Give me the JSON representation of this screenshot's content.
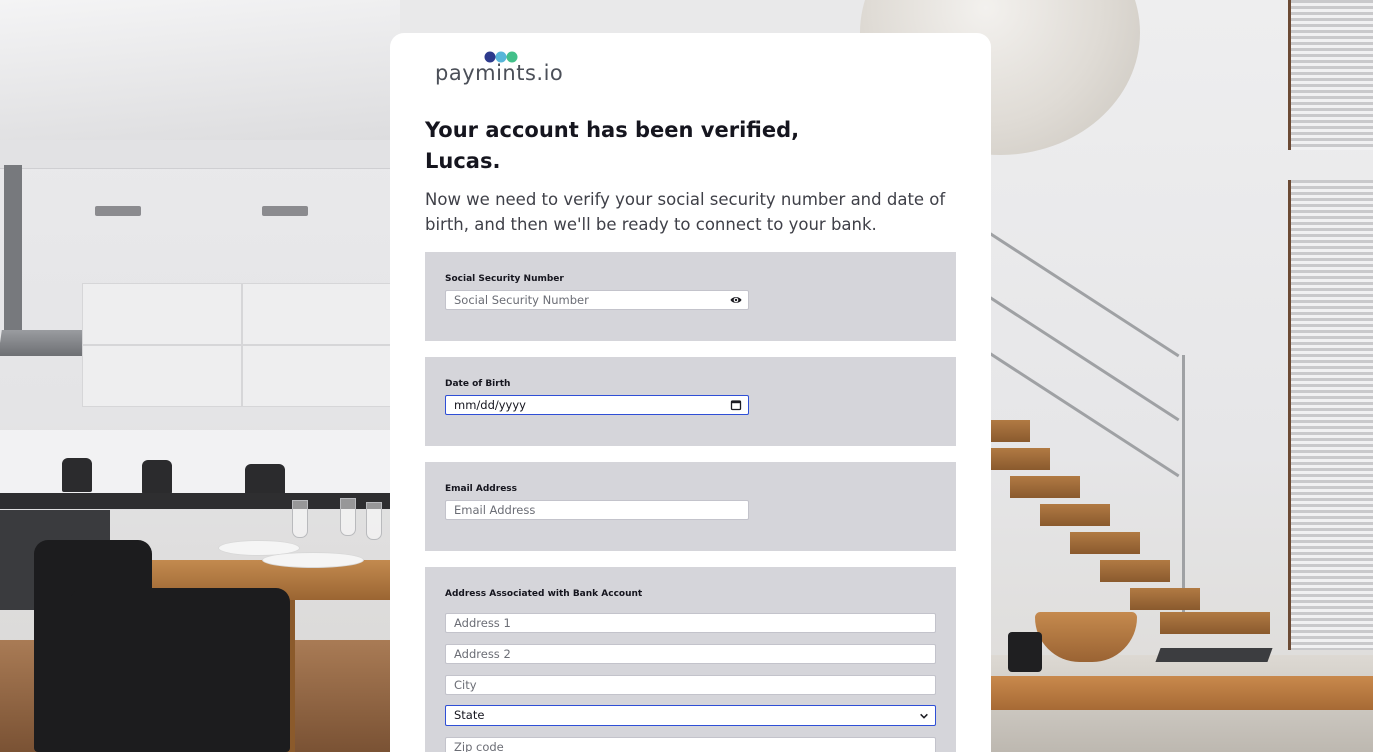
{
  "brand": {
    "logo_text": "paymints.io",
    "dot_colors": [
      "#2d3a8c",
      "#57b6d9",
      "#43c08a"
    ]
  },
  "heading": {
    "line1": "Your account has been verified,",
    "line2": "Lucas."
  },
  "intro": "Now we need to verify your social security number and date of birth, and then we'll be ready to connect to your bank.",
  "form": {
    "ssn": {
      "label": "Social Security Number",
      "placeholder": "Social Security Number",
      "icon": "eye-icon"
    },
    "dob": {
      "label": "Date of Birth",
      "placeholder": "mm/dd/yyyy",
      "icon": "calendar-icon"
    },
    "email": {
      "label": "Email Address",
      "placeholder": "Email Address"
    },
    "address": {
      "label": "Address Associated with Bank Account",
      "address1_placeholder": "Address 1",
      "address2_placeholder": "Address 2",
      "city_placeholder": "City",
      "state_selected": "State",
      "state_icon": "chevron-down-icon",
      "zip_placeholder": "Zip code"
    }
  },
  "colors": {
    "section_bg": "#d5d5da",
    "focus_border": "#2f4fd6",
    "heading_text": "#15151e"
  }
}
